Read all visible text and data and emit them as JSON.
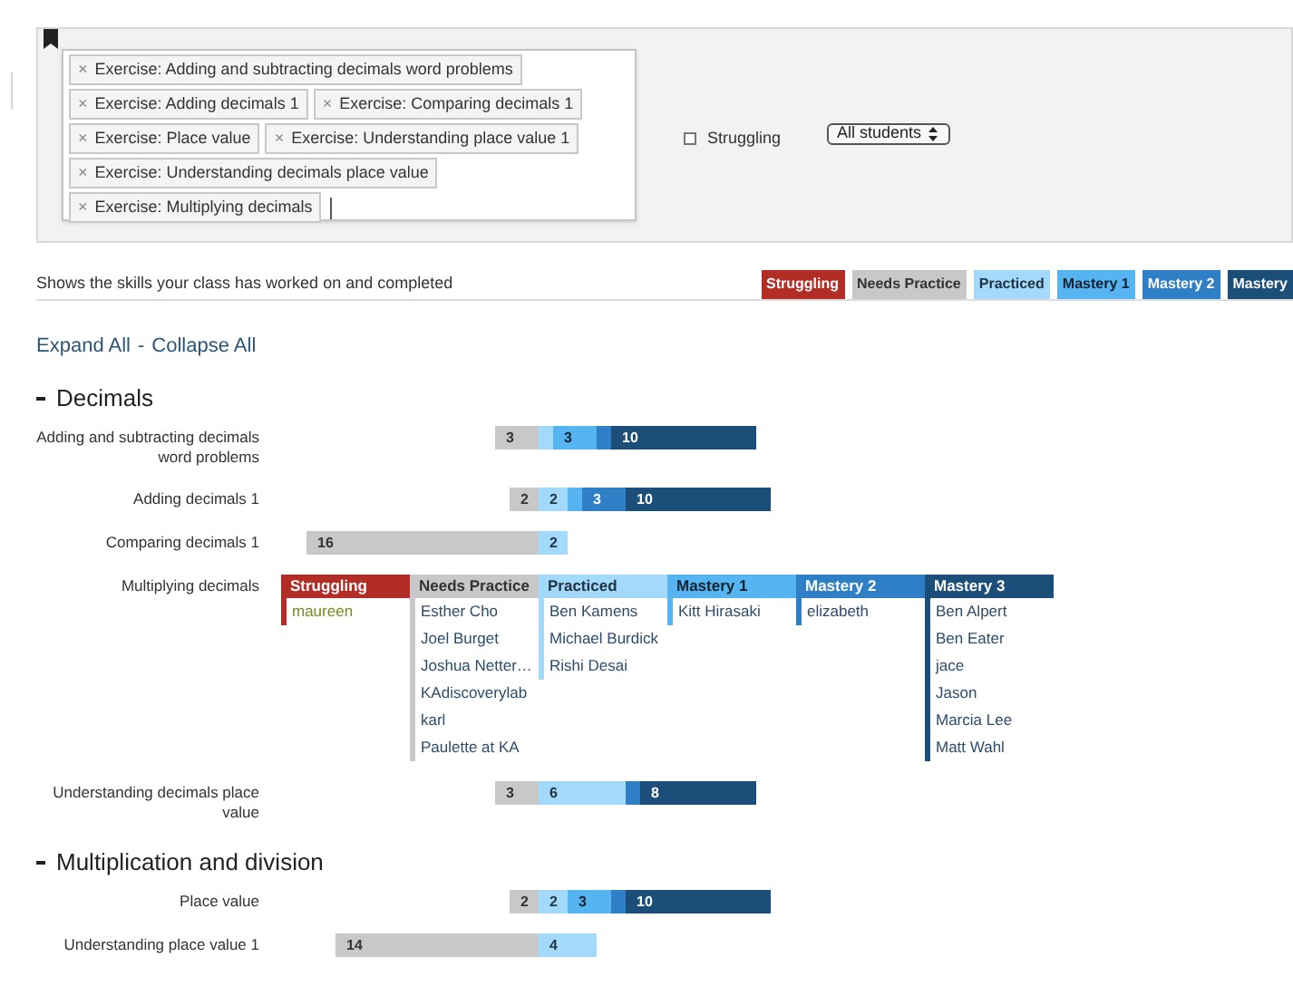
{
  "filter": {
    "tags": [
      {
        "remove": "×",
        "label": "Exercise: Adding and subtracting decimals word problems"
      },
      {
        "remove": "×",
        "label": "Exercise: Adding decimals 1"
      },
      {
        "remove": "×",
        "label": "Exercise: Comparing decimals 1"
      },
      {
        "remove": "×",
        "label": "Exercise: Place value"
      },
      {
        "remove": "×",
        "label": "Exercise: Understanding place value 1"
      },
      {
        "remove": "×",
        "label": "Exercise: Understanding decimals place value"
      },
      {
        "remove": "×",
        "label": "Exercise: Multiplying decimals"
      }
    ],
    "struggling_checkbox": {
      "label": "Struggling",
      "checked": false
    },
    "student_select": {
      "value": "All students"
    }
  },
  "description": "Shows the skills your class has worked on and completed",
  "legend": [
    {
      "kind": "struggling",
      "label": "Struggling"
    },
    {
      "kind": "needs_practice",
      "label": "Needs Practice"
    },
    {
      "kind": "practiced",
      "label": "Practiced"
    },
    {
      "kind": "mastery1",
      "label": "Mastery 1"
    },
    {
      "kind": "mastery2",
      "label": "Mastery 2"
    },
    {
      "kind": "mastery3",
      "label": "Mastery"
    }
  ],
  "expand_all": "Expand All",
  "separator": "-",
  "collapse_all": "Collapse All",
  "sections": [
    {
      "title": "Decimals",
      "expanded": true,
      "skills": [
        {
          "name": "Adding and subtracting decimals word problems",
          "expanded": false,
          "segments": [
            {
              "kind": "needs_practice",
              "count": "3"
            },
            {
              "kind": "practiced"
            },
            {
              "kind": "mastery1",
              "count": "3"
            },
            {
              "kind": "mastery2"
            },
            {
              "kind": "mastery3",
              "count": "10"
            }
          ]
        },
        {
          "name": "Adding decimals 1",
          "expanded": false,
          "segments": [
            {
              "kind": "needs_practice",
              "count": "2"
            },
            {
              "kind": "practiced",
              "count": "2"
            },
            {
              "kind": "mastery1"
            },
            {
              "kind": "mastery2",
              "count": "3"
            },
            {
              "kind": "mastery3",
              "count": "10"
            }
          ]
        },
        {
          "name": "Comparing decimals 1",
          "expanded": false,
          "segments": [
            {
              "kind": "needs_practice",
              "count": "16"
            },
            {
              "kind": "practiced",
              "count": "2"
            }
          ]
        },
        {
          "name": "Multiplying decimals",
          "expanded": true,
          "columns": [
            {
              "kind": "struggling",
              "header": "Struggling",
              "students": [
                "maureen"
              ]
            },
            {
              "kind": "needs_practice",
              "header": "Needs Practice",
              "students": [
                "Esther Cho",
                "Joel Burget",
                "Joshua Netter…",
                "KAdiscoverylab",
                "karl",
                "Paulette at KA"
              ]
            },
            {
              "kind": "practiced",
              "header": "Practiced",
              "students": [
                "Ben Kamens",
                "Michael Burdick",
                "Rishi Desai"
              ]
            },
            {
              "kind": "mastery1",
              "header": "Mastery 1",
              "students": [
                "Kitt Hirasaki"
              ]
            },
            {
              "kind": "mastery2",
              "header": "Mastery 2",
              "students": [
                "elizabeth"
              ]
            },
            {
              "kind": "mastery3",
              "header": "Mastery 3",
              "students": [
                "Ben Alpert",
                "Ben Eater",
                "jace",
                "Jason",
                "Marcia Lee",
                "Matt Wahl"
              ]
            }
          ]
        },
        {
          "name": "Understanding decimals place value",
          "expanded": false,
          "segments": [
            {
              "kind": "needs_practice",
              "count": "3"
            },
            {
              "kind": "practiced",
              "count": "6"
            },
            {
              "kind": "mastery2"
            },
            {
              "kind": "mastery3",
              "count": "8"
            }
          ]
        }
      ]
    },
    {
      "title": "Multiplication and division",
      "expanded": true,
      "skills": [
        {
          "name": "Place value",
          "expanded": false,
          "segments": [
            {
              "kind": "needs_practice",
              "count": "2"
            },
            {
              "kind": "practiced",
              "count": "2"
            },
            {
              "kind": "mastery1",
              "count": "3"
            },
            {
              "kind": "mastery2"
            },
            {
              "kind": "mastery3",
              "count": "10"
            }
          ]
        },
        {
          "name": "Understanding place value 1",
          "expanded": false,
          "segments": [
            {
              "kind": "needs_practice",
              "count": "14"
            },
            {
              "kind": "practiced",
              "count": "4"
            }
          ]
        }
      ]
    }
  ]
}
